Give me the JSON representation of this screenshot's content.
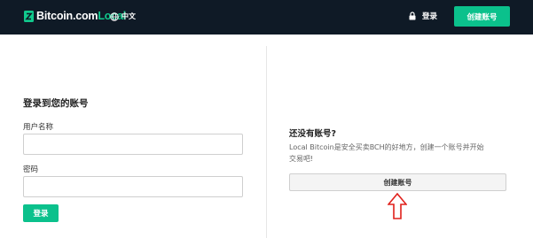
{
  "header": {
    "brand_main": "Bitcoin.com",
    "brand_accent": "Local",
    "language": "中文",
    "login_label": "登录",
    "create_account_label": "创建账号"
  },
  "login": {
    "title": "登录到您的账号",
    "username_label": "用户名称",
    "username_value": "",
    "password_label": "密码",
    "password_value": "",
    "submit_label": "登录"
  },
  "signup": {
    "title": "还没有账号?",
    "description": "Local Bitcoin是安全买卖BCH的好地方，创建一个账号并开始交易吧!",
    "create_account_label": "创建账号"
  },
  "icons": {
    "brand": "bitcoin-logo-icon",
    "language": "globe-icon",
    "login": "lock-icon",
    "annotation": "up-arrow-icon"
  },
  "colors": {
    "header_bg": "#0f1a26",
    "accent_green": "#0bc18c",
    "annotation_red": "#e0201b"
  }
}
